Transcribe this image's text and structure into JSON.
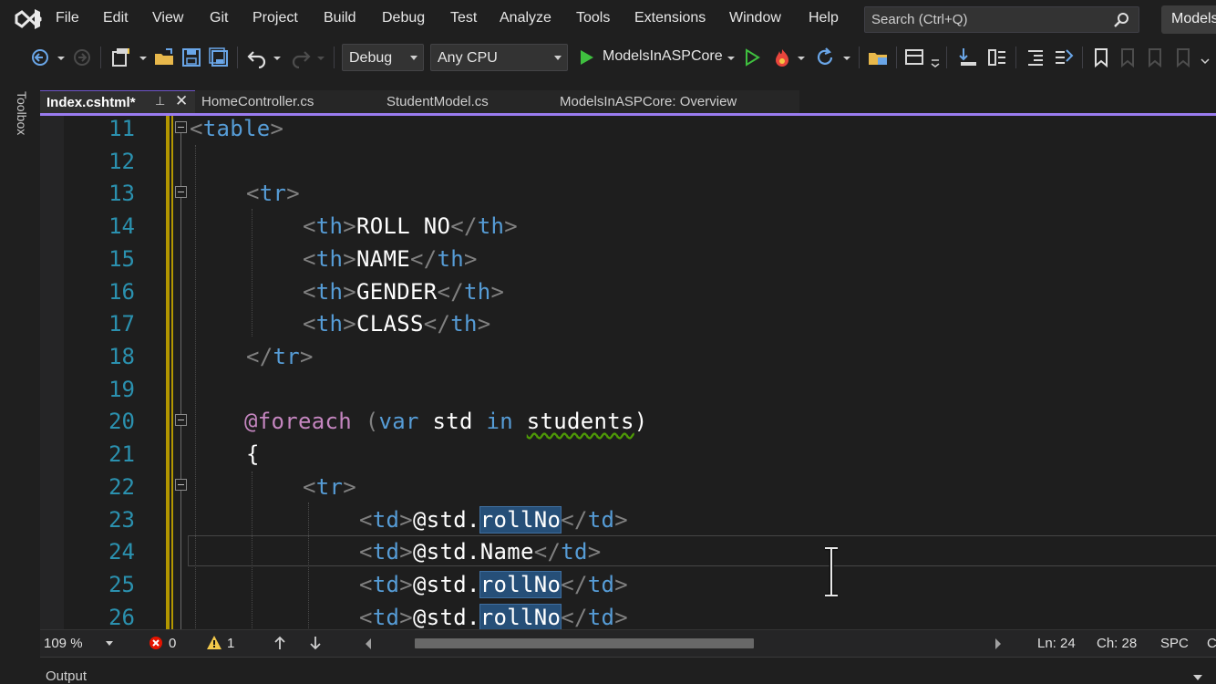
{
  "menu": {
    "items": [
      "File",
      "Edit",
      "View",
      "Git",
      "Project",
      "Build",
      "Debug",
      "Test",
      "Analyze",
      "Tools",
      "Extensions",
      "Window",
      "Help"
    ],
    "search_placeholder": "Search (Ctrl+Q)",
    "title_chip": "ModelsInASPCore"
  },
  "toolbar": {
    "config": "Debug",
    "platform": "Any CPU",
    "run_target": "ModelsInASPCore"
  },
  "toolbox": {
    "label": "Toolbox"
  },
  "tabs": [
    {
      "label": "Index.cshtml*",
      "active": true
    },
    {
      "label": "HomeController.cs",
      "active": false
    },
    {
      "label": "StudentModel.cs",
      "active": false
    },
    {
      "label": "ModelsInASPCore: Overview",
      "active": false
    }
  ],
  "tab_pin_glyph": "⊥",
  "tab_close_glyph": "✕",
  "editor": {
    "lines": [
      {
        "n": "11"
      },
      {
        "n": "12"
      },
      {
        "n": "13"
      },
      {
        "n": "14"
      },
      {
        "n": "15"
      },
      {
        "n": "16"
      },
      {
        "n": "17"
      },
      {
        "n": "18"
      },
      {
        "n": "19"
      },
      {
        "n": "20"
      },
      {
        "n": "21"
      },
      {
        "n": "22"
      },
      {
        "n": "23"
      },
      {
        "n": "24"
      },
      {
        "n": "25"
      },
      {
        "n": "26"
      }
    ],
    "code": {
      "l11": {
        "open": "<",
        "tag": "table",
        "close": ">"
      },
      "l13": {
        "open": "<",
        "tag": "tr",
        "close": ">"
      },
      "l14": {
        "tag": "th",
        "text": "ROLL NO"
      },
      "l15": {
        "tag": "th",
        "text": "NAME"
      },
      "l16": {
        "tag": "th",
        "text": "GENDER"
      },
      "l17": {
        "tag": "th",
        "text": "CLASS"
      },
      "l18": {
        "tag": "tr"
      },
      "l20": {
        "at": "@",
        "kw_foreach": "foreach",
        "paren_open": " (",
        "kw_var": "var",
        "var_name": " std ",
        "kw_in": "in",
        "collection": "students",
        "paren_close": ")"
      },
      "l21": {
        "brace": "{"
      },
      "l22": {
        "tag": "tr"
      },
      "l23": {
        "tag": "td",
        "obj": "@std.",
        "member": "rollNo"
      },
      "l24": {
        "tag": "td",
        "obj": "@std.",
        "member": "Name"
      },
      "l25": {
        "tag": "td",
        "obj": "@std.",
        "member": "rollNo"
      },
      "l26": {
        "tag": "td",
        "obj": "@std.",
        "member": "rollNo"
      }
    }
  },
  "status": {
    "zoom": "109 %",
    "errors": "0",
    "warnings": "1",
    "line": "Ln: 24",
    "col": "Ch: 28",
    "spacing": "SPC",
    "crlf": "CRLF"
  },
  "output": {
    "title": "Output"
  },
  "colors": {
    "accent": "#9a7cf0",
    "line_number": "#2b91af",
    "tag": "#569cd6",
    "razor": "#c586c0",
    "selection": "#264f78",
    "change_bar": "#b39700"
  }
}
